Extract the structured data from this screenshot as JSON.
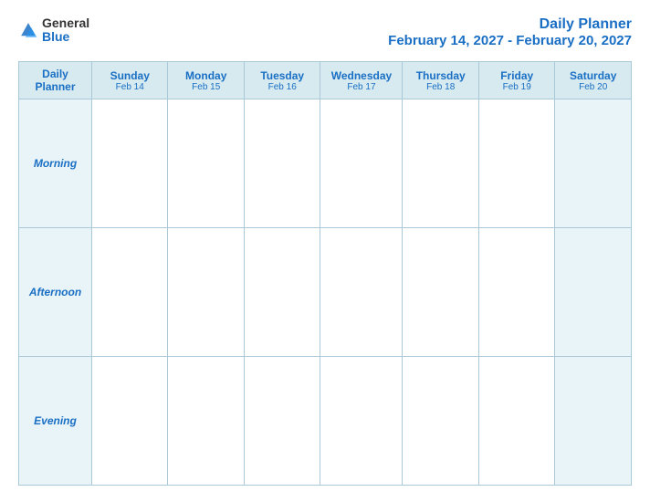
{
  "header": {
    "logo": {
      "general": "General",
      "blue": "Blue"
    },
    "title": "Daily Planner",
    "date_range": "February 14, 2027 - February 20, 2027"
  },
  "table": {
    "label_header": {
      "line1": "Daily",
      "line2": "Planner"
    },
    "columns": [
      {
        "day": "Sunday",
        "date": "Feb 14"
      },
      {
        "day": "Monday",
        "date": "Feb 15"
      },
      {
        "day": "Tuesday",
        "date": "Feb 16"
      },
      {
        "day": "Wednesday",
        "date": "Feb 17"
      },
      {
        "day": "Thursday",
        "date": "Feb 18"
      },
      {
        "day": "Friday",
        "date": "Feb 19"
      },
      {
        "day": "Saturday",
        "date": "Feb 20"
      }
    ],
    "rows": [
      {
        "label": "Morning"
      },
      {
        "label": "Afternoon"
      },
      {
        "label": "Evening"
      }
    ]
  }
}
